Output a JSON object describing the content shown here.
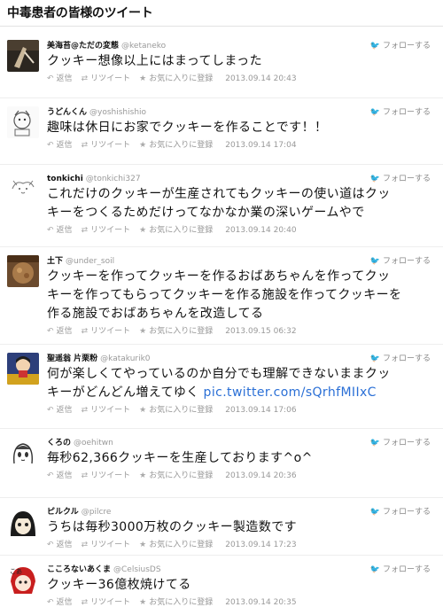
{
  "page": {
    "title": "中毒患者の皆様のツイート"
  },
  "labels": {
    "follow": "フォローする",
    "reply": "返信",
    "retweet": "リツイート",
    "favorite": "お気に入りに登録"
  },
  "icons": {
    "follow": "twitter-bird-icon",
    "reply": "reply-arrow-icon",
    "retweet": "retweet-icon",
    "favorite": "star-icon"
  },
  "colors": {
    "bird": "#55acee",
    "link": "#2a6fd6",
    "meta": "#999999"
  },
  "tweets": [
    {
      "name": "美海苔@ただの変態",
      "handle": "@ketaneko",
      "lines": [
        "クッキー想像以上にはまってしまった"
      ],
      "link": "",
      "time": "2013.09.14 20:43",
      "avatar": "dark-photo"
    },
    {
      "name": "うどんくん",
      "handle": "@yoshishishio",
      "lines": [
        "趣味は休日にお家でクッキーを作ることです！！"
      ],
      "link": "",
      "time": "2013.09.14 17:04",
      "avatar": "sketch"
    },
    {
      "name": "tonkichi",
      "handle": "@tonkichi327",
      "lines": [
        "これだけのクッキーが生産されてもクッキーの使い道はクッ",
        "キーをつくるためだけってなかなか業の深いゲームやで"
      ],
      "link": "",
      "time": "2013.09.14 20:40",
      "avatar": "cat-sketch"
    },
    {
      "name": "土下",
      "handle": "@under_soil",
      "lines": [
        "クッキーを作ってクッキーを作るおばあちゃんを作ってクッ",
        "キーを作ってもらってクッキーを作る施設を作ってクッキーを",
        "作る施設でおばあちゃんを改造してる"
      ],
      "link": "",
      "time": "2013.09.15 06:32",
      "avatar": "brown-photo"
    },
    {
      "name": "聖遥翁 片栗粉",
      "handle": "@katakurik0",
      "lines": [
        "何が楽しくてやっているのか自分でも理解できないままクッ",
        "キーがどんどん増えてゆく "
      ],
      "link": "pic.twitter.com/sQrhfMIIxC",
      "time": "2013.09.14 17:06",
      "avatar": "colorful"
    },
    {
      "name": "くろの",
      "handle": "@oehitwn",
      "lines": [
        "毎秒62,366クッキーを生産しております^o^"
      ],
      "link": "",
      "time": "2013.09.14 20:36",
      "avatar": "anime"
    },
    {
      "name": "ピルクル",
      "handle": "@pilcre",
      "lines": [
        "うちは毎秒3000万枚のクッキー製造数です"
      ],
      "link": "",
      "time": "2013.09.14 17:23",
      "avatar": "anime-dark"
    },
    {
      "name": "こころないあくま",
      "handle": "@CelsiusDS",
      "lines": [
        "クッキー36億枚焼けてる"
      ],
      "link": "",
      "time": "2013.09.14 20:35",
      "avatar": "red-char"
    }
  ]
}
